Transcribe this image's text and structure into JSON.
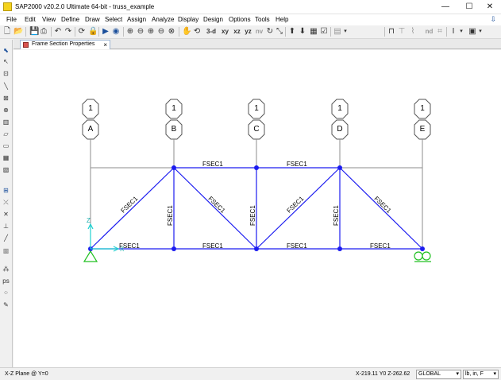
{
  "window": {
    "title": "SAP2000 v20.2.0 Ultimate 64-bit - truss_example",
    "minimize_glyph": "—",
    "maximize_glyph": "☐",
    "close_glyph": "✕"
  },
  "menu": {
    "items": [
      "File",
      "Edit",
      "View",
      "Define",
      "Draw",
      "Select",
      "Assign",
      "Analyze",
      "Display",
      "Design",
      "Options",
      "Tools",
      "Help"
    ],
    "download_icon": "download-icon"
  },
  "toolbar": {
    "view_3d": "3-d",
    "view_xy": "xy",
    "view_xz": "xz",
    "view_yz": "yz",
    "view_nv": "nv",
    "view_nd": "nd",
    "dropdown_glyph": "▾"
  },
  "tab": {
    "label": "Frame Section Properties",
    "close_glyph": "×"
  },
  "canvas": {
    "grid_bubbles": [
      {
        "number": "1",
        "letter": "A"
      },
      {
        "number": "1",
        "letter": "B"
      },
      {
        "number": "1",
        "letter": "C"
      },
      {
        "number": "1",
        "letter": "D"
      },
      {
        "number": "1",
        "letter": "E"
      }
    ],
    "frame_label": "FSEC1",
    "axis_z": "Z",
    "axis_x": "X",
    "colors": {
      "member": "#1c1cf0",
      "joint": "#1c1cf0",
      "grid": "#8c8c8c",
      "support": "#20c020",
      "axis": "#20d0d0"
    }
  },
  "status": {
    "view": "X-Z Plane @ Y=0",
    "coords": "X-219.11  Y0   Z-262.62",
    "coord_system": "GLOBAL",
    "units": "lb, in, F"
  }
}
